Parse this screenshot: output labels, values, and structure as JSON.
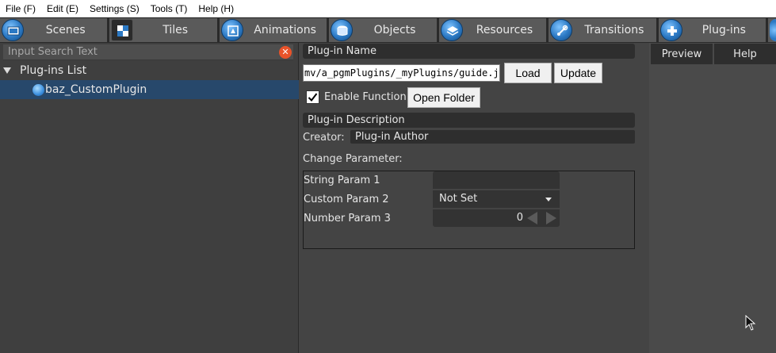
{
  "menu": [
    {
      "label": "File (F)"
    },
    {
      "label": "Edit (E)"
    },
    {
      "label": "Settings (S)"
    },
    {
      "label": "Tools (T)"
    },
    {
      "label": "Help (H)"
    }
  ],
  "tabs": [
    {
      "label": "Scenes",
      "icon": "scenes-icon"
    },
    {
      "label": "Tiles",
      "icon": "tiles-icon"
    },
    {
      "label": "Animations",
      "icon": "animations-icon"
    },
    {
      "label": "Objects",
      "icon": "objects-icon"
    },
    {
      "label": "Resources",
      "icon": "resources-icon"
    },
    {
      "label": "Transitions",
      "icon": "transitions-icon"
    },
    {
      "label": "Plug-ins",
      "icon": "plugins-icon",
      "active": true
    }
  ],
  "left_panel": {
    "search_placeholder": "Input Search Text",
    "tree_root": "Plug-ins List",
    "tree_item": "baz_CustomPlugin"
  },
  "plugin": {
    "name_header": "Plug-in Name",
    "path": "mv/a_pgmPlugins/_myPlugins/guide.js",
    "load_label": "Load",
    "update_label": "Update",
    "enable_label": "Enable Function",
    "enable_checked": true,
    "open_folder_label": "Open Folder",
    "description_header": "Plug-in Description",
    "creator_label": "Creator:",
    "author": "Plug-in Author",
    "change_param_label": "Change Parameter:",
    "params": [
      {
        "label": "String Param 1",
        "type": "string",
        "value": ""
      },
      {
        "label": "Custom Param 2",
        "type": "select",
        "value": "Not Set"
      },
      {
        "label": "Number Param 3",
        "type": "number",
        "value": "0"
      }
    ]
  },
  "right_panel": {
    "tabs": [
      "Preview",
      "Help"
    ]
  },
  "colors": {
    "accent_blue": "#2c79c4",
    "selection": "#27486b",
    "clear_button": "#e8532a"
  }
}
